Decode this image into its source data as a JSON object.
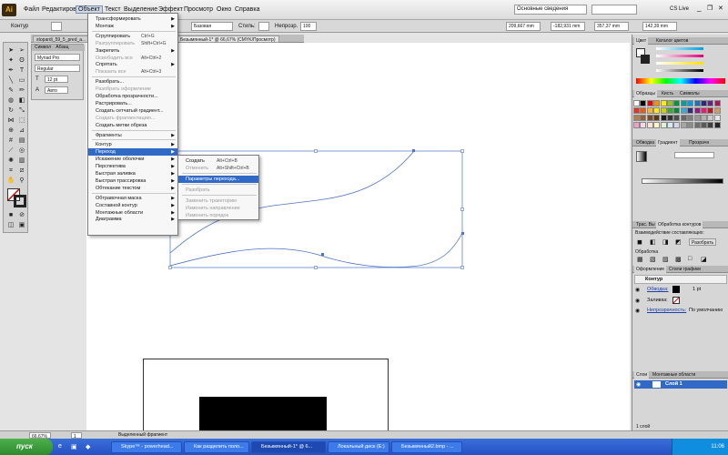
{
  "menubar": {
    "items": [
      "Файл",
      "Редактирование",
      "Объект",
      "Текст",
      "Выделение",
      "Эффект",
      "Просмотр",
      "Окно",
      "Справка"
    ],
    "workspace": "Основные сведения",
    "search_placeholder": "",
    "cs_live": "CS Live"
  },
  "control": {
    "label": "Контур",
    "stroke_style": "Базовая",
    "style_label": "Стиль:",
    "opacity_label": "Непрозр.",
    "opacity_value": "100",
    "x_value": "209,667 mm",
    "y_value": "-182,931 mm",
    "w_value": "357,37 mm",
    "h_value": "142,39 mm"
  },
  "doc_tabs": [
    "stopardi_59_5_pred_a...",
    "Безымянный-1* @ 66,67% (CMYK/Просмотр)"
  ],
  "char_panel": {
    "tabs": [
      "Символ",
      "Абзац"
    ],
    "font": "Myriad Pro",
    "style": "Regular",
    "size": "12 pt",
    "leading": "Авто"
  },
  "object_menu": [
    {
      "label": "Трансформировать",
      "shortcut": "",
      "arrow": true,
      "disabled": false
    },
    {
      "label": "Монтаж",
      "shortcut": "",
      "arrow": true,
      "disabled": false
    },
    {
      "sep": true
    },
    {
      "label": "Сгруппировать",
      "shortcut": "Ctrl+G",
      "arrow": false,
      "disabled": false
    },
    {
      "label": "Разгруппировать",
      "shortcut": "Shift+Ctrl+G",
      "arrow": false,
      "disabled": true
    },
    {
      "label": "Закрепить",
      "shortcut": "",
      "arrow": true,
      "disabled": false
    },
    {
      "label": "Освободить все",
      "shortcut": "Alt+Ctrl+2",
      "arrow": false,
      "disabled": true
    },
    {
      "label": "Спрятать",
      "shortcut": "",
      "arrow": true,
      "disabled": false
    },
    {
      "label": "Показать все",
      "shortcut": "Alt+Ctrl+3",
      "arrow": false,
      "disabled": true
    },
    {
      "sep": true
    },
    {
      "label": "Разобрать...",
      "shortcut": "",
      "arrow": false,
      "disabled": false
    },
    {
      "label": "Разобрать оформление",
      "shortcut": "",
      "arrow": false,
      "disabled": true
    },
    {
      "label": "Обработка прозрачности...",
      "shortcut": "",
      "arrow": false,
      "disabled": false
    },
    {
      "label": "Растрировать...",
      "shortcut": "",
      "arrow": false,
      "disabled": false
    },
    {
      "label": "Создать сетчатый градиент...",
      "shortcut": "",
      "arrow": false,
      "disabled": false
    },
    {
      "label": "Создать фрагментацию...",
      "shortcut": "",
      "arrow": false,
      "disabled": true
    },
    {
      "label": "Создать метки обреза",
      "shortcut": "",
      "arrow": false,
      "disabled": false
    },
    {
      "sep": true
    },
    {
      "label": "Фрагменты",
      "shortcut": "",
      "arrow": true,
      "disabled": false
    },
    {
      "sep": true
    },
    {
      "label": "Контур",
      "shortcut": "",
      "arrow": true,
      "disabled": false
    },
    {
      "label": "Переход",
      "shortcut": "",
      "arrow": true,
      "disabled": false,
      "selected": true
    },
    {
      "label": "Искажение оболочки",
      "shortcut": "",
      "arrow": true,
      "disabled": false
    },
    {
      "label": "Перспектива",
      "shortcut": "",
      "arrow": true,
      "disabled": false
    },
    {
      "label": "Быстрая заливка",
      "shortcut": "",
      "arrow": true,
      "disabled": false
    },
    {
      "label": "Быстрая трассировка",
      "shortcut": "",
      "arrow": true,
      "disabled": false
    },
    {
      "label": "Обтекание текстом",
      "shortcut": "",
      "arrow": true,
      "disabled": false
    },
    {
      "sep": true
    },
    {
      "label": "Обтравочная маска",
      "shortcut": "",
      "arrow": true,
      "disabled": false
    },
    {
      "label": "Составной контур",
      "shortcut": "",
      "arrow": true,
      "disabled": false
    },
    {
      "label": "Монтажные области",
      "shortcut": "",
      "arrow": true,
      "disabled": false
    },
    {
      "label": "Диаграмма",
      "shortcut": "",
      "arrow": true,
      "disabled": false
    }
  ],
  "blend_submenu": [
    {
      "label": "Создать",
      "shortcut": "Alt+Ctrl+B",
      "disabled": false
    },
    {
      "label": "Отменить",
      "shortcut": "Alt+Shift+Ctrl+B",
      "disabled": true
    },
    {
      "sep": true
    },
    {
      "label": "Параметры перехода...",
      "shortcut": "",
      "disabled": false,
      "selected": true
    },
    {
      "sep": true
    },
    {
      "label": "Разобрать",
      "shortcut": "",
      "disabled": true
    },
    {
      "sep": true
    },
    {
      "label": "Заменить траекторию",
      "shortcut": "",
      "disabled": true
    },
    {
      "label": "Изменить направление",
      "shortcut": "",
      "disabled": true
    },
    {
      "label": "Изменить порядок",
      "shortcut": "",
      "disabled": true
    }
  ],
  "color_panel": {
    "tabs": [
      "Цвет",
      "Каталог цветов"
    ]
  },
  "swatches_panel": {
    "tabs": [
      "Образцы",
      "Кисть",
      "Символы"
    ]
  },
  "gradient_panel": {
    "tabs": [
      "Обводка",
      "Градиент",
      "Прозрачн"
    ]
  },
  "pathfinder_panel": {
    "tabs": [
      "Трас. Вы",
      "Обработка контуров"
    ],
    "modes_label": "Взаимодействие составляющих:",
    "expand_label": "Разобрать",
    "pathfinders_label": "Обработка"
  },
  "appearance_panel": {
    "tabs": [
      "Оформление",
      "Стили графики"
    ],
    "title": "Контур",
    "stroke_label": "Обводка:",
    "stroke_weight": "1 pt",
    "fill_label": "Заливка:",
    "opacity_label": "Непрозрачность:",
    "opacity_value": "По умолчанию"
  },
  "layers_panel": {
    "tabs": [
      "Слои",
      "Монтажные области"
    ],
    "layer_name": "Слой 1",
    "count": "1 слой"
  },
  "status": {
    "zoom": "66,67%",
    "page": "1",
    "mode": "Выделенный фрагмент"
  },
  "taskbar": {
    "start": "пуск",
    "tasks": [
      "Skype™ - powerhead...",
      "Как разделить поло...",
      "Безымянный-1* @ 6...",
      "Локальный диск (E:)",
      "Безымянный2.bmp - ..."
    ],
    "clock": "11:06"
  },
  "colors": {
    "accent": "#3169c6",
    "taskbar": "#2551c4",
    "start": "#2e8a2e",
    "brand": "#f7a800"
  }
}
